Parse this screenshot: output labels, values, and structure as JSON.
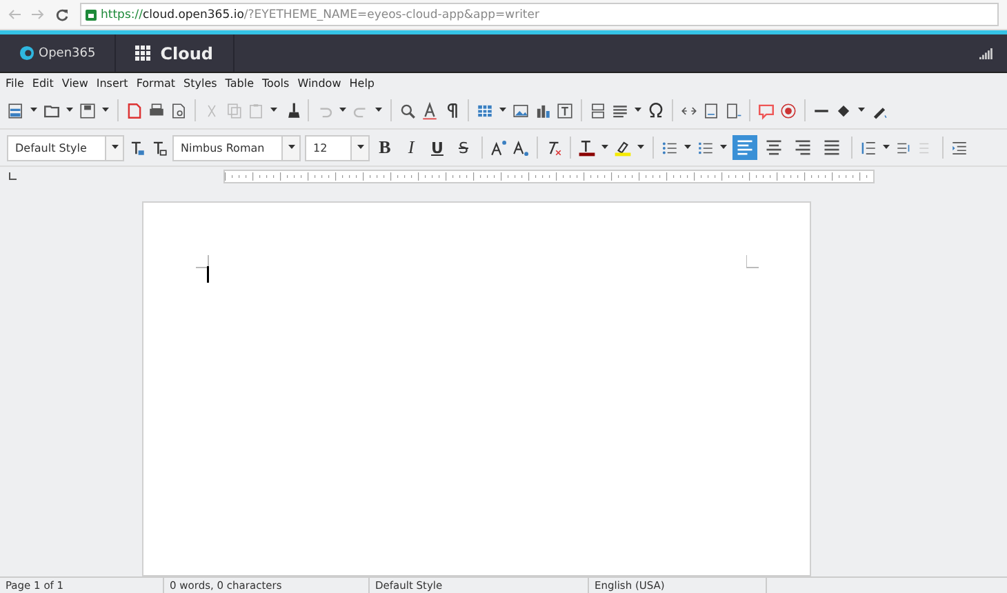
{
  "browser": {
    "scheme": "https://",
    "host": "cloud.open365.io",
    "path": "/?EYETHEME_NAME=eyeos-cloud-app&app=writer"
  },
  "header": {
    "logo": "Open365",
    "app": "Cloud"
  },
  "menu": [
    "File",
    "Edit",
    "View",
    "Insert",
    "Format",
    "Styles",
    "Table",
    "Tools",
    "Window",
    "Help"
  ],
  "formatting": {
    "paragraph_style": "Default Style",
    "font_name": "Nimbus Roman",
    "font_size": "12",
    "text_styles": [
      {
        "label": "B",
        "kind": "bold"
      },
      {
        "label": "I",
        "kind": "italic"
      },
      {
        "label": "U",
        "kind": "underline"
      },
      {
        "label": "S",
        "kind": "strike"
      }
    ],
    "alignment": [
      {
        "kind": "left",
        "selected": true
      },
      {
        "kind": "center",
        "selected": false
      },
      {
        "kind": "right",
        "selected": false
      },
      {
        "kind": "justify",
        "selected": false
      }
    ]
  },
  "status_bar": {
    "page": "Page 1 of 1",
    "words": "0 words, 0 characters",
    "style": "Default Style",
    "language": "English (USA)"
  }
}
